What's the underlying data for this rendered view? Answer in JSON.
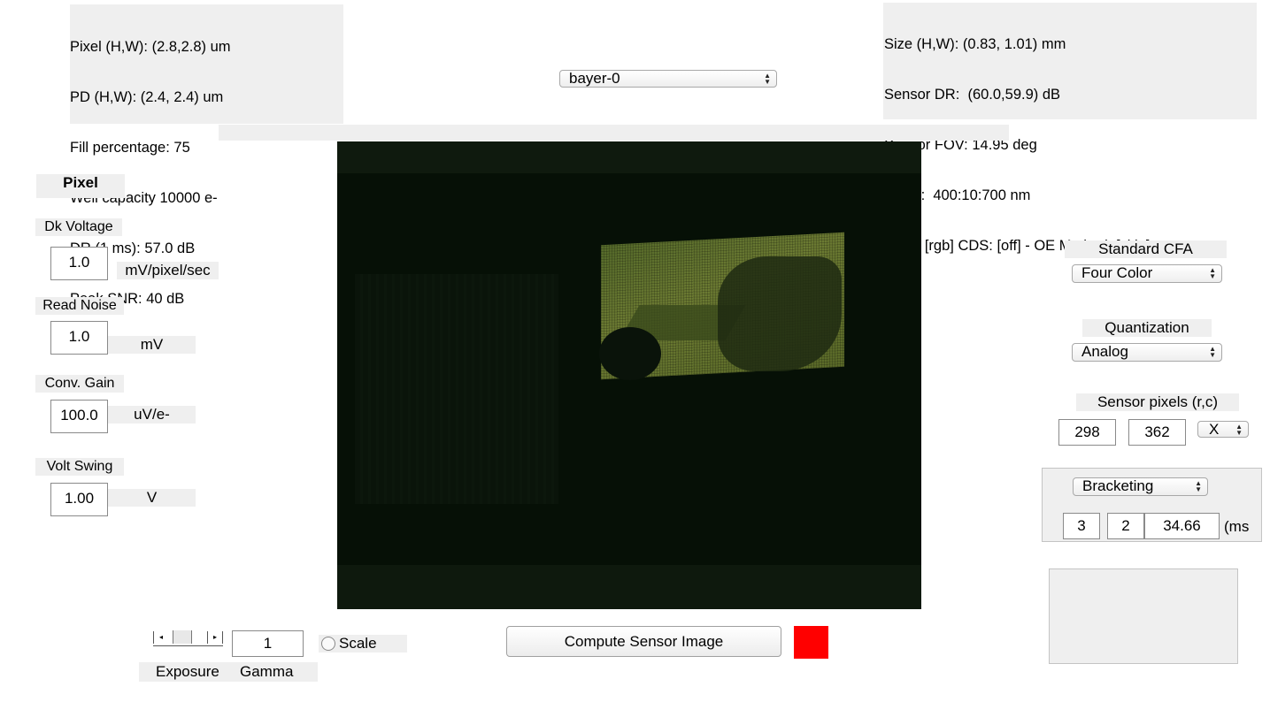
{
  "pixel_info": [
    "Pixel (H,W): (2.8,2.8) um",
    "PD (H,W): (2.4, 2.4) um",
    "Fill percentage: 75",
    "Well capacity 10000 e-",
    "DR (1 ms): 57.0 dB",
    "Peak SNR: 40 dB"
  ],
  "sensor_info": [
    "Size (H,W): (0.83, 1.01) mm",
    "Sensor DR:  (60.0,59.9) dB",
    "Sensor FOV: 14.95 deg",
    "Wave:  400:10:700 nm",
    "CFA:  [rgb] CDS: [off] - OE Method: [skip]"
  ],
  "sensor_select": {
    "value": "bayer-0"
  },
  "pixel_panel": {
    "title": "Pixel",
    "dk_voltage": {
      "label": "Dk Voltage",
      "value": "1.0",
      "unit": "mV/pixel/sec"
    },
    "read_noise": {
      "label": "Read Noise",
      "value": "1.0",
      "unit": "mV"
    },
    "conv_gain": {
      "label": "Conv. Gain",
      "value": "100.0",
      "unit": "uV/e-"
    },
    "volt_swing": {
      "label": "Volt Swing",
      "value": "1.00",
      "unit": "V"
    }
  },
  "right_panel": {
    "cfa_label": "Standard CFA",
    "cfa_value": "Four Color",
    "quant_label": "Quantization",
    "quant_value": "Analog",
    "pixels_label": "Sensor pixels  (r,c)",
    "rows": "298",
    "cols": "362",
    "size_mode": "X",
    "exposure_mode": "Bracketing",
    "bracket_n": "3",
    "bracket_step": "2",
    "bracket_time": "34.66",
    "time_unit": "(ms"
  },
  "bottom": {
    "gamma_value": "1",
    "scale_label": "Scale",
    "exposure_label": "Exposure",
    "gamma_label": "Gamma",
    "compute_label": "Compute Sensor  Image"
  },
  "colors": {
    "panel_gray": "#efefef",
    "status_indicator": "#ff0000"
  }
}
